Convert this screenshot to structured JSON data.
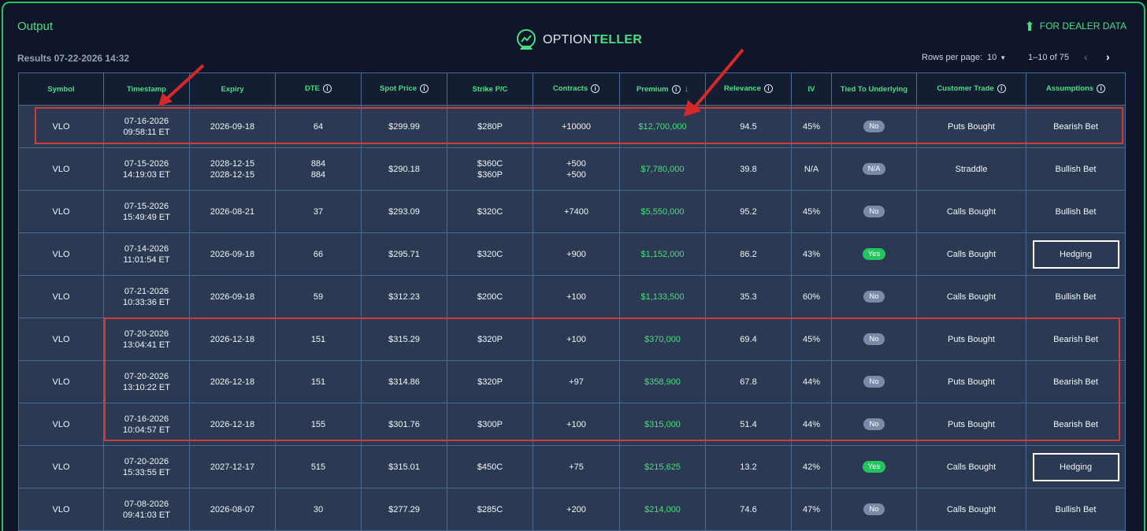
{
  "header": {
    "title": "Output",
    "results_label": "Results 07-22-2026 14:32",
    "logo_text_a": "OPTION",
    "logo_text_b": "TELLER",
    "dealer_link": "FOR DEALER DATA"
  },
  "pagination": {
    "rows_per_page_label": "Rows per page:",
    "rows_per_page_value": "10",
    "range_label": "1–10 of 75"
  },
  "columns": [
    "Symbol",
    "Timestamp",
    "Expiry",
    "DTE",
    "Spot Price",
    "Strike P/C",
    "Contracts",
    "Premium",
    "Relevance",
    "IV",
    "Tied To Underlying",
    "Customer Trade",
    "Assumptions"
  ],
  "rows": [
    {
      "symbol": "VLO",
      "ts_date": "07-16-2026",
      "ts_time": "09:58:11 ET",
      "expiry": [
        "2026-09-18"
      ],
      "dte": [
        "64"
      ],
      "spot": "$299.99",
      "strike": [
        "$280P"
      ],
      "contracts": [
        "+10000"
      ],
      "premium": "$12,700,000",
      "relevance": "94.5",
      "iv": "45%",
      "tied": "No",
      "trade": "Puts Bought",
      "assumption": "Bearish Bet",
      "assumption_boxed": false
    },
    {
      "symbol": "VLO",
      "ts_date": "07-15-2026",
      "ts_time": "14:19:03 ET",
      "expiry": [
        "2028-12-15",
        "2028-12-15"
      ],
      "dte": [
        "884",
        "884"
      ],
      "spot": "$290.18",
      "strike": [
        "$360C",
        "$360P"
      ],
      "contracts": [
        "+500",
        "+500"
      ],
      "premium": "$7,780,000",
      "relevance": "39.8",
      "iv": "N/A",
      "tied": "N/A",
      "trade": "Straddle",
      "assumption": "Bullish Bet",
      "assumption_boxed": false
    },
    {
      "symbol": "VLO",
      "ts_date": "07-15-2026",
      "ts_time": "15:49:49 ET",
      "expiry": [
        "2026-08-21"
      ],
      "dte": [
        "37"
      ],
      "spot": "$293.09",
      "strike": [
        "$320C"
      ],
      "contracts": [
        "+7400"
      ],
      "premium": "$5,550,000",
      "relevance": "95.2",
      "iv": "45%",
      "tied": "No",
      "trade": "Calls Bought",
      "assumption": "Bullish Bet",
      "assumption_boxed": false
    },
    {
      "symbol": "VLO",
      "ts_date": "07-14-2026",
      "ts_time": "11:01:54 ET",
      "expiry": [
        "2026-09-18"
      ],
      "dte": [
        "66"
      ],
      "spot": "$295.71",
      "strike": [
        "$320C"
      ],
      "contracts": [
        "+900"
      ],
      "premium": "$1,152,000",
      "relevance": "86.2",
      "iv": "43%",
      "tied": "Yes",
      "trade": "Calls Bought",
      "assumption": "Hedging",
      "assumption_boxed": true
    },
    {
      "symbol": "VLO",
      "ts_date": "07-21-2026",
      "ts_time": "10:33:36 ET",
      "expiry": [
        "2026-09-18"
      ],
      "dte": [
        "59"
      ],
      "spot": "$312.23",
      "strike": [
        "$200C"
      ],
      "contracts": [
        "+100"
      ],
      "premium": "$1,133,500",
      "relevance": "35.3",
      "iv": "60%",
      "tied": "No",
      "trade": "Calls Bought",
      "assumption": "Bullish Bet",
      "assumption_boxed": false
    },
    {
      "symbol": "VLO",
      "ts_date": "07-20-2026",
      "ts_time": "13:04:41 ET",
      "expiry": [
        "2026-12-18"
      ],
      "dte": [
        "151"
      ],
      "spot": "$315.29",
      "strike": [
        "$320P"
      ],
      "contracts": [
        "+100"
      ],
      "premium": "$370,000",
      "relevance": "69.4",
      "iv": "45%",
      "tied": "No",
      "trade": "Puts Bought",
      "assumption": "Bearish Bet",
      "assumption_boxed": false
    },
    {
      "symbol": "VLO",
      "ts_date": "07-20-2026",
      "ts_time": "13:10:22 ET",
      "expiry": [
        "2026-12-18"
      ],
      "dte": [
        "151"
      ],
      "spot": "$314.86",
      "strike": [
        "$320P"
      ],
      "contracts": [
        "+97"
      ],
      "premium": "$358,900",
      "relevance": "67.8",
      "iv": "44%",
      "tied": "No",
      "trade": "Puts Bought",
      "assumption": "Bearish Bet",
      "assumption_boxed": false
    },
    {
      "symbol": "VLO",
      "ts_date": "07-16-2026",
      "ts_time": "10:04:57 ET",
      "expiry": [
        "2026-12-18"
      ],
      "dte": [
        "155"
      ],
      "spot": "$301.76",
      "strike": [
        "$300P"
      ],
      "contracts": [
        "+100"
      ],
      "premium": "$315,000",
      "relevance": "51.4",
      "iv": "44%",
      "tied": "No",
      "trade": "Puts Bought",
      "assumption": "Bearish Bet",
      "assumption_boxed": false
    },
    {
      "symbol": "VLO",
      "ts_date": "07-20-2026",
      "ts_time": "15:33:55 ET",
      "expiry": [
        "2027-12-17"
      ],
      "dte": [
        "515"
      ],
      "spot": "$315.01",
      "strike": [
        "$450C"
      ],
      "contracts": [
        "+75"
      ],
      "premium": "$215,625",
      "relevance": "13.2",
      "iv": "42%",
      "tied": "Yes",
      "trade": "Calls Bought",
      "assumption": "Hedging",
      "assumption_boxed": true
    },
    {
      "symbol": "VLO",
      "ts_date": "07-08-2026",
      "ts_time": "09:41:03 ET",
      "expiry": [
        "2026-08-07"
      ],
      "dte": [
        "30"
      ],
      "spot": "$277.29",
      "strike": [
        "$285C"
      ],
      "contracts": [
        "+200"
      ],
      "premium": "$214,000",
      "relevance": "74.6",
      "iv": "47%",
      "tied": "No",
      "trade": "Calls Bought",
      "assumption": "Bullish Bet",
      "assumption_boxed": false
    }
  ],
  "info_columns": [
    "DTE",
    "Spot Price",
    "Contracts",
    "Premium",
    "Relevance",
    "Customer Trade",
    "Assumptions"
  ],
  "sorted_column": "Premium",
  "colors": {
    "accent": "#4ade80",
    "highlight": "#d23a3a",
    "row_bg": "#2b3a52",
    "header_bg": "#141e33"
  }
}
